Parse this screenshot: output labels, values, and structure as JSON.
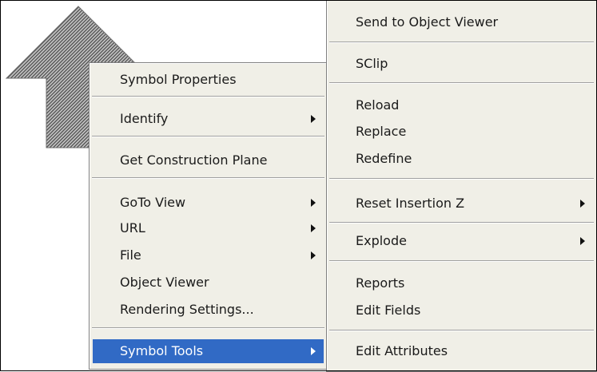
{
  "left_menu": {
    "items": [
      {
        "label": "Symbol Properties"
      },
      {
        "label": "Identify",
        "has_submenu": true
      },
      {
        "label": "Get Construction Plane"
      },
      {
        "label": "GoTo View",
        "has_submenu": true
      },
      {
        "label": "URL",
        "has_submenu": true
      },
      {
        "label": "File",
        "has_submenu": true
      },
      {
        "label": "Object Viewer"
      },
      {
        "label": "Rendering Settings..."
      },
      {
        "label": "Symbol Tools",
        "has_submenu": true,
        "selected": true
      }
    ]
  },
  "right_menu": {
    "items": [
      {
        "label": "Send to Object Viewer"
      },
      {
        "label": "SClip"
      },
      {
        "label": "Reload"
      },
      {
        "label": "Replace"
      },
      {
        "label": "Redefine"
      },
      {
        "label": "Reset Insertion Z",
        "has_submenu": true
      },
      {
        "label": "Explode",
        "has_submenu": true
      },
      {
        "label": "Reports"
      },
      {
        "label": "Edit Fields"
      },
      {
        "label": "Edit Attributes"
      }
    ]
  },
  "colors": {
    "menu_background": "#f0efe7",
    "selection": "#316ac5",
    "arrow_fill": "#8a8a8a"
  },
  "icons": [
    "up-arrow-cursor-icon",
    "submenu-arrow-icon"
  ]
}
